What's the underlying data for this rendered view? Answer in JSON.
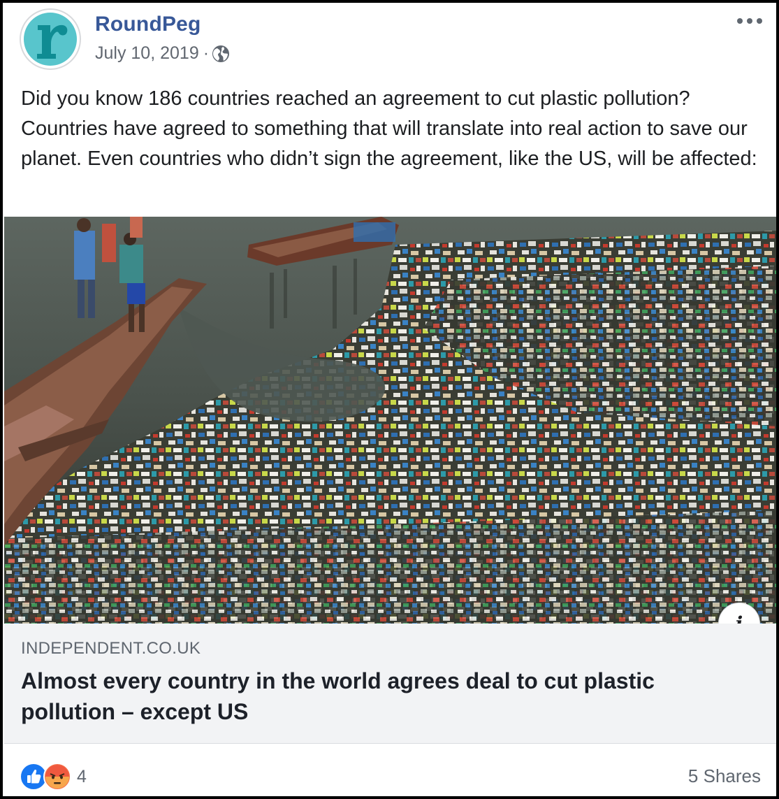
{
  "post": {
    "page_name": "RoundPeg",
    "avatar_letter": "r",
    "date": "July 10, 2019",
    "separator": "·",
    "privacy_icon": "globe-icon",
    "more_icon": "more-horizontal-icon",
    "text": "Did you know 186 countries reached an agreement to cut plastic pollution? Countries have agreed to something that will translate into real action to save our planet. Even countries who didn’t sign the agreement, like the US, will be affected:"
  },
  "link_preview": {
    "image_icon": "photo-plastic-waste-river",
    "info_label": "i",
    "domain": "INDEPENDENT.CO.UK",
    "headline": "Almost every country in the world agrees deal to cut plastic pollution – except US"
  },
  "footer": {
    "reaction_icons": [
      "like-icon",
      "angry-icon"
    ],
    "reaction_count": "4",
    "shares": "5 Shares"
  },
  "colors": {
    "page_name": "#385898",
    "avatar_bg": "#58c5cc",
    "avatar_letter": "#0f8c93",
    "link_box_bg": "#f2f3f5",
    "like_blue": "#1877f2",
    "angry_orange": "#f7714c"
  }
}
